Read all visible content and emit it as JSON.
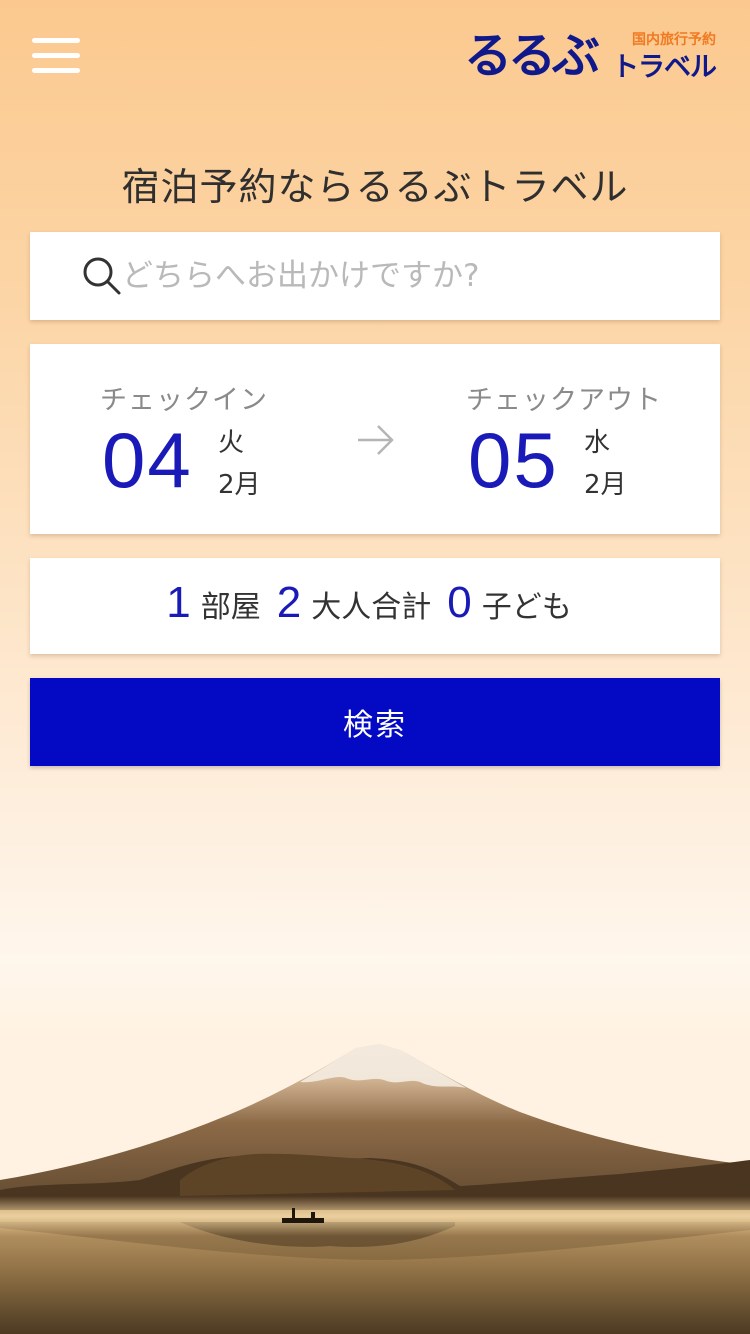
{
  "header": {
    "menu_icon": "hamburger-menu-icon",
    "logo": {
      "main": "るるぶ",
      "sub": "国内旅行予約",
      "travel": "トラベル"
    }
  },
  "headline": "宿泊予約ならるるぶトラベル",
  "search": {
    "icon": "search-icon",
    "placeholder": "どちらへお出かけですか?",
    "value": ""
  },
  "dates": {
    "checkin": {
      "label": "チェックイン",
      "day": "04",
      "weekday": "火",
      "month": "2月"
    },
    "arrow_icon": "arrow-right-icon",
    "checkout": {
      "label": "チェックアウト",
      "day": "05",
      "weekday": "水",
      "month": "2月"
    }
  },
  "guests": {
    "rooms": "1",
    "rooms_label": "部屋",
    "adults": "2",
    "adults_label": "大人合計",
    "children": "0",
    "children_label": "子ども"
  },
  "search_button_label": "検索",
  "colors": {
    "brand_navy": "#10198c",
    "brand_orange": "#f07a22",
    "accent_blue": "#1a1ab8",
    "button_blue": "#0409c4"
  }
}
